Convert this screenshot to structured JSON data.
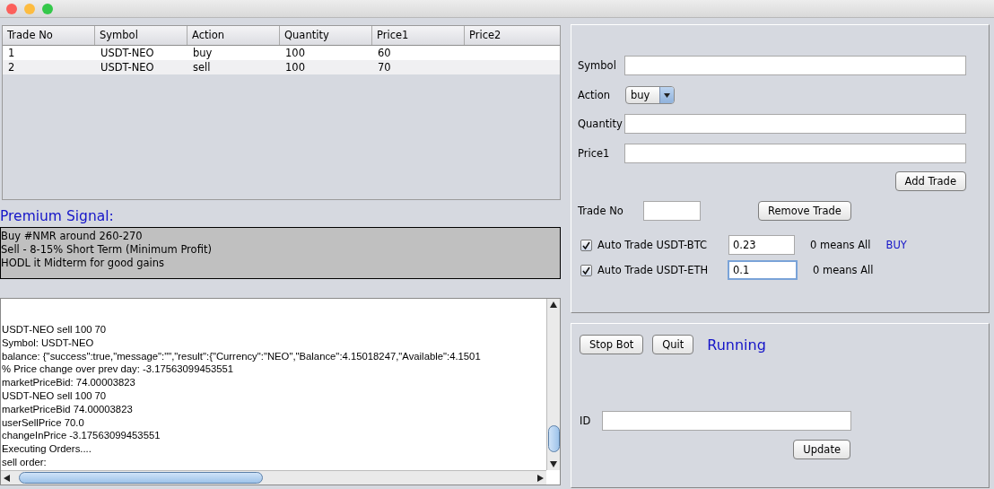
{
  "table": {
    "columns": [
      "Trade No",
      "Symbol",
      "Action",
      "Quantity",
      "Price1",
      "Price2"
    ],
    "rows": [
      [
        "1",
        "USDT-NEO",
        "buy",
        "100",
        "60",
        ""
      ],
      [
        "2",
        "USDT-NEO",
        "sell",
        "100",
        "70",
        ""
      ]
    ]
  },
  "premium_signal": {
    "label": "Premium Signal:",
    "lines": [
      "Buy #NMR around 260-270",
      "Sell - 8-15% Short Term (Minimum Profit)",
      "HODL it Midterm for good gains"
    ]
  },
  "log": {
    "lines": [
      "USDT-NEO sell 100 70",
      "Symbol: USDT-NEO",
      "balance: {\"success\":true,\"message\":\"\",\"result\":{\"Currency\":\"NEO\",\"Balance\":4.15018247,\"Available\":4.1501",
      "% Price change over prev day: -3.17563099453551",
      "marketPriceBid: 74.00003823",
      "USDT-NEO sell 100 70",
      "marketPriceBid 74.00003823",
      "userSellPrice 70.0",
      "changeInPrice -3.17563099453551",
      "Executing Orders....",
      "sell order:"
    ]
  },
  "trade_form": {
    "fields": [
      {
        "kind": "text",
        "label": "Symbol"
      },
      {
        "kind": "select",
        "label": "Action",
        "value": "buy"
      },
      {
        "kind": "text",
        "label": "Quantity"
      },
      {
        "kind": "text",
        "label": "Price1"
      }
    ],
    "add_button": "Add Trade",
    "trade_no_label": "Trade No",
    "remove_button": "Remove Trade",
    "auto_trades": [
      {
        "label": "Auto Trade USDT-BTC",
        "checked": true,
        "value": "0.23",
        "focused": false,
        "hint": "0 means All",
        "signal": "BUY"
      },
      {
        "label": "Auto Trade USDT-ETH",
        "checked": true,
        "value": "0.1",
        "focused": true,
        "hint": "0 means All"
      }
    ]
  },
  "bot_panel": {
    "buttons": [
      "Stop Bot",
      "Quit"
    ],
    "status": "Running",
    "id_label": "ID",
    "update_button": "Update"
  }
}
